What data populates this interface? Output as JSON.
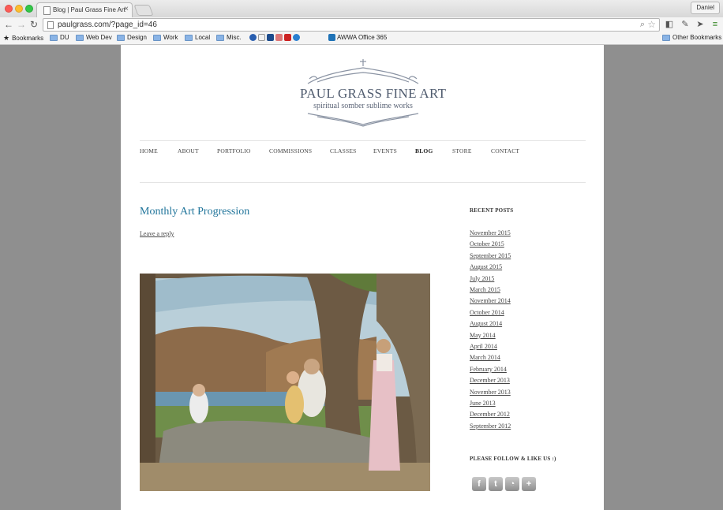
{
  "browser": {
    "tab_title": "Blog | Paul Grass Fine Art",
    "tab_close": "×",
    "profile_name": "Daniel",
    "url": "paulgrass.com/?page_id=46",
    "bookmarks": [
      {
        "label": "Bookmarks",
        "icon": "star-icon"
      },
      {
        "label": "DU",
        "icon": "folder-icon"
      },
      {
        "label": "Web Dev",
        "icon": "folder-icon"
      },
      {
        "label": "Design",
        "icon": "folder-icon"
      },
      {
        "label": "Work",
        "icon": "folder-icon"
      },
      {
        "label": "Local",
        "icon": "folder-icon"
      },
      {
        "label": "Misc.",
        "icon": "folder-icon"
      },
      {
        "label": "AWWA Office 365",
        "icon": "sharepoint-icon"
      }
    ],
    "other_bookmarks": "Other Bookmarks"
  },
  "site": {
    "logo_title": "PAUL GRASS FINE ART",
    "logo_subtitle": "spiritual somber sublime works",
    "menu": [
      "HOME",
      "ABOUT",
      "PORTFOLIO",
      "COMMISSIONS",
      "CLASSES",
      "EVENTS",
      "BLOG",
      "STORE",
      "CONTACT"
    ],
    "active_menu": "BLOG"
  },
  "post": {
    "title": "Monthly Art Progression",
    "reply_link": "Leave a reply"
  },
  "sidebar": {
    "recent_heading": "RECENT POSTS",
    "archives": [
      "November 2015",
      "October 2015",
      "September 2015",
      "August 2015",
      "July 2015",
      "March 2015",
      "November 2014",
      "October 2014",
      "August 2014",
      "May 2014",
      "April 2014",
      "March 2014",
      "February 2014",
      "December 2013",
      "November 2013",
      "June 2013",
      "December 2012",
      "September 2012"
    ],
    "follow_heading": "PLEASE FOLLOW & LIKE US :)",
    "social": [
      "facebook-icon",
      "twitter-icon",
      "rss-icon",
      "google-plus-icon"
    ]
  },
  "colors": {
    "link_blue": "#21759b",
    "chrome_bg": "#f4f4f4",
    "page_bg": "#8f8f8f"
  }
}
